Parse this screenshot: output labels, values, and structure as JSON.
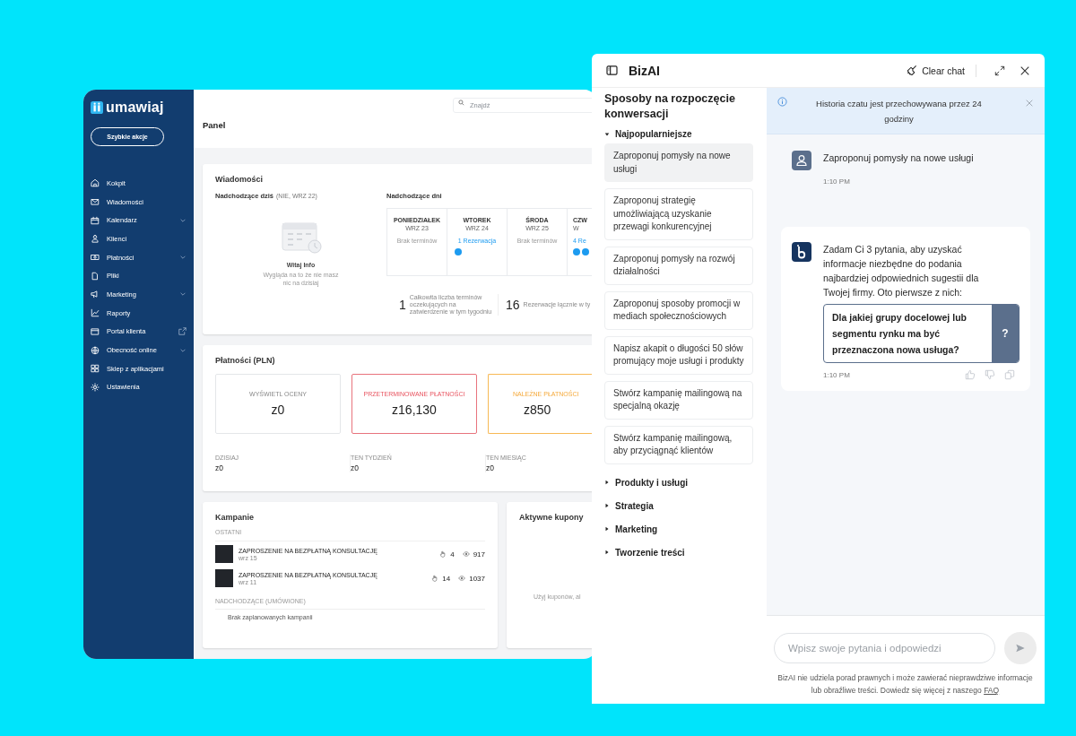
{
  "dashboard": {
    "logo": "umawiaj",
    "quick_action": "Szybkie akcje",
    "nav": [
      {
        "label": "Kokpit",
        "kind": "plain"
      },
      {
        "label": "Wiadomości",
        "kind": "plain"
      },
      {
        "label": "Kalendarz",
        "kind": "expandable"
      },
      {
        "label": "Klienci",
        "kind": "plain"
      },
      {
        "label": "Płatności",
        "kind": "expandable"
      },
      {
        "label": "Pliki",
        "kind": "plain"
      },
      {
        "label": "Marketing",
        "kind": "expandable"
      },
      {
        "label": "Raporty",
        "kind": "plain"
      },
      {
        "label": "Portal klienta",
        "kind": "external"
      },
      {
        "label": "Obecność online",
        "kind": "expandable"
      },
      {
        "label": "Sklep z aplikacjami",
        "kind": "plain"
      },
      {
        "label": "Ustawienia",
        "kind": "plain"
      }
    ],
    "search": {
      "placeholder": "Znajdź"
    },
    "page_title": "Panel",
    "messages_card": {
      "title": "Wiadomości",
      "today": {
        "label": "Nadchodzące dziś",
        "date": "(NIE, WRZ 22)",
        "empty_title": "Witaj Info",
        "empty_text": "Wygląda na to że nie masz nic na dzisiaj"
      },
      "upcoming": {
        "label": "Nadchodzące dni",
        "days": [
          {
            "name": "PONIEDZIAŁEK",
            "date": "WRZ 23",
            "status": "Brak terminów",
            "kind": "empty"
          },
          {
            "name": "WTOREK",
            "date": "WRZ 24",
            "status": "1 Rezerwacja",
            "kind": "booked",
            "dots": [
              {
                "color": "#1d9bf0"
              }
            ]
          },
          {
            "name": "ŚRODA",
            "date": "WRZ 25",
            "status": "Brak terminów",
            "kind": "empty"
          },
          {
            "name": "CZW",
            "date": "W",
            "status": "4 Re",
            "kind": "booked",
            "dots": [
              {
                "color": "#1d9bf0"
              },
              {
                "color": "#1d9bf0"
              }
            ]
          }
        ]
      },
      "stats": [
        {
          "value": "1",
          "label": "Całkowita liczba terminów oczekujących na zatwierdzenie w tym tygodniu"
        },
        {
          "value": "16",
          "label": "Rezerwacje łącznie w ty"
        }
      ]
    },
    "payments": {
      "title": "Płatności (PLN)",
      "tiles": [
        {
          "label": "WYŚWIETL OCENY",
          "amount": "z0",
          "kind": "neutral"
        },
        {
          "label": "PRZETERMINOWANE PŁATNOŚCI",
          "amount": "z16,130",
          "kind": "overdue"
        },
        {
          "label": "NALEŻNE PŁATNOŚCI",
          "amount": "z850",
          "kind": "due"
        }
      ],
      "periods": [
        {
          "label": "DZISIAJ",
          "amount": "z0"
        },
        {
          "label": "TEN TYDZIEŃ",
          "amount": "z0"
        },
        {
          "label": "TEN MIESIĄC",
          "amount": "z0"
        }
      ]
    },
    "campaigns": {
      "title": "Kampanie",
      "recent_label": "OSTATNI",
      "items": [
        {
          "title": "ZAPROSZENIE NA BEZPŁATNĄ KONSULTACJĘ",
          "date": "wrz 15",
          "clicks": "4",
          "views": "917"
        },
        {
          "title": "ZAPROSZENIE NA BEZPŁATNĄ KONSULTACJĘ",
          "date": "wrz 11",
          "clicks": "14",
          "views": "1037"
        }
      ],
      "upcoming_label": "NADCHODZĄCE (UMÓWIONE)",
      "empty": "Brak zaplanowanych kampanii"
    },
    "coupons": {
      "title": "Aktywne kupony",
      "text": "Użyj kuponów, al"
    }
  },
  "chat": {
    "title": "BizAI",
    "clear": "Clear chat",
    "starters": {
      "title": "Sposoby na rozpoczęcie konwersacji",
      "groups": [
        {
          "label": "Najpopularniejsze",
          "expanded": true,
          "prompts": [
            {
              "text": "Zaproponuj pomysły na nowe usługi",
              "selected": true
            },
            {
              "text": "Zaproponuj strategię umożliwiającą uzyskanie przewagi konkurencyjnej",
              "selected": false
            },
            {
              "text": "Zaproponuj pomysły na rozwój działalności",
              "selected": false
            },
            {
              "text": "Zaproponuj sposoby promocji w mediach społecznościowych",
              "selected": false
            },
            {
              "text": "Napisz akapit o długości 50 słów promujący moje usługi i produkty",
              "selected": false
            },
            {
              "text": "Stwórz kampanię mailingową na specjalną okazję",
              "selected": false
            },
            {
              "text": "Stwórz kampanię mailingową, aby przyciągnąć klientów",
              "selected": false
            }
          ]
        },
        {
          "label": "Produkty i usługi",
          "expanded": false
        },
        {
          "label": "Strategia",
          "expanded": false
        },
        {
          "label": "Marketing",
          "expanded": false
        },
        {
          "label": "Tworzenie treści",
          "expanded": false
        }
      ]
    },
    "notice": {
      "text": "Historia czatu jest przechowywana przez 24 godziny"
    },
    "messages": [
      {
        "kind": "user",
        "text": "Zaproponuj pomysły na nowe usługi",
        "time": "1:10 PM"
      },
      {
        "kind": "bot",
        "text": "Zadam Ci 3 pytania, aby uzyskać informacje niezbędne do podania najbardziej odpowiednich sugestii dla Twojej firmy. Oto pierwsze z nich:",
        "question": "Dla jakiej grupy docelowej lub segmentu rynku ma być przeznaczona nowa usługa?",
        "question_mark": "?",
        "time": "1:10 PM"
      }
    ],
    "input": {
      "placeholder": "Wpisz swoje pytania i odpowiedzi"
    },
    "disclaimer": {
      "text": "BizAI nie udziela porad prawnych i może zawierać nieprawdziwe informacje lub obraźliwe treści. Dowiedz się więcej z naszego",
      "link": "FAQ"
    }
  }
}
